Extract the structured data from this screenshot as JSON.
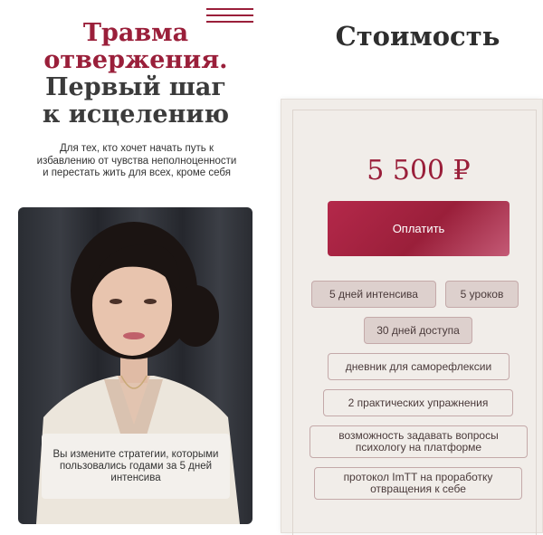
{
  "header": {
    "title_accent": [
      "Травма",
      "отвержения."
    ],
    "title_rest": [
      "Первый шаг",
      "к исцелению"
    ],
    "subtitle": "Для тех, кто хочет начать путь к избавлению от чувства неполноценности и перестать жить для всех, кроме себя"
  },
  "photo": {
    "caption": "Вы измените стратегии, которыми пользовались годами за 5 дней интенсива"
  },
  "pricing": {
    "title": "Стоимость",
    "price": "5 500 ₽",
    "pay_label": "Оплатить",
    "highlights": [
      "5 дней интенсива",
      "5 уроков",
      "30 дней доступа"
    ],
    "features": [
      "дневник для саморефлексии",
      "2 практических упражнения",
      "возможность задавать вопросы психологу на платформе",
      "протокол ImTT на проработку отвращения к себе"
    ]
  },
  "colors": {
    "accent": "#9a1f3a",
    "card_bg": "#f1ede9",
    "tag_filled": "#ddd0cd"
  },
  "icons": {
    "menu": "hamburger-menu-icon"
  }
}
